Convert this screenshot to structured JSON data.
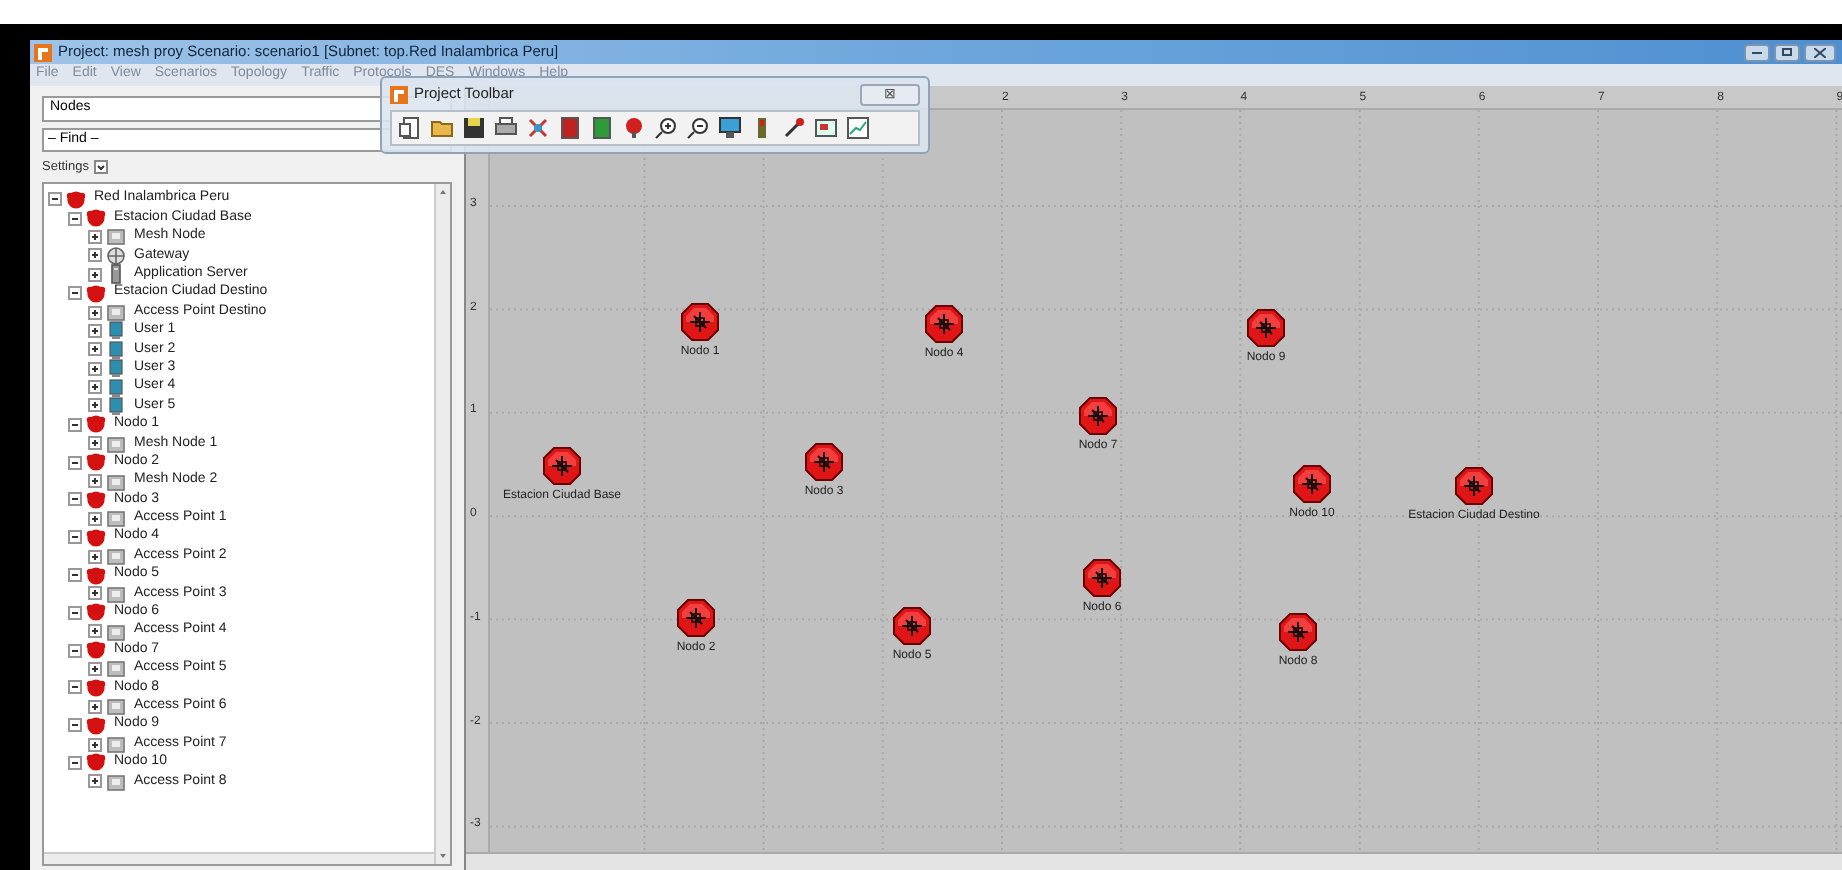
{
  "window": {
    "title": "Project: mesh proy Scenario: scenario1  [Subnet: top.Red Inalambrica Peru]"
  },
  "menu": [
    "File",
    "Edit",
    "View",
    "Scenarios",
    "Topology",
    "Traffic",
    "Protocols",
    "DES",
    "Windows",
    "Help"
  ],
  "toolbar_window": {
    "title": "Project Toolbar",
    "close": "⊠"
  },
  "panel": {
    "view_selector": {
      "value": "Nodes"
    },
    "find_field": {
      "value": "– Find –"
    },
    "settings_label": "Settings",
    "tree": [
      {
        "label": "Red Inalambrica Peru",
        "kind": "subnet",
        "expanded": true,
        "children": [
          {
            "label": "Estacion Ciudad Base",
            "kind": "subnet",
            "expanded": true,
            "children": [
              {
                "label": "Mesh Node",
                "kind": "device",
                "expanded": false
              },
              {
                "label": "Gateway",
                "kind": "gateway",
                "expanded": false
              },
              {
                "label": "Application Server",
                "kind": "server",
                "expanded": false
              }
            ]
          },
          {
            "label": "Estacion Ciudad Destino",
            "kind": "subnet",
            "expanded": true,
            "children": [
              {
                "label": "Access Point Destino",
                "kind": "device",
                "expanded": false
              },
              {
                "label": "User 1",
                "kind": "user",
                "expanded": false
              },
              {
                "label": "User 2",
                "kind": "user",
                "expanded": false
              },
              {
                "label": "User 3",
                "kind": "user",
                "expanded": false
              },
              {
                "label": "User 4",
                "kind": "user",
                "expanded": false
              },
              {
                "label": "User 5",
                "kind": "user",
                "expanded": false
              }
            ]
          },
          {
            "label": "Nodo 1",
            "kind": "subnet",
            "expanded": true,
            "children": [
              {
                "label": "Mesh Node 1",
                "kind": "device",
                "expanded": false
              }
            ]
          },
          {
            "label": "Nodo 2",
            "kind": "subnet",
            "expanded": true,
            "children": [
              {
                "label": "Mesh Node 2",
                "kind": "device",
                "expanded": false
              }
            ]
          },
          {
            "label": "Nodo 3",
            "kind": "subnet",
            "expanded": true,
            "children": [
              {
                "label": "Access Point 1",
                "kind": "device",
                "expanded": false
              }
            ]
          },
          {
            "label": "Nodo 4",
            "kind": "subnet",
            "expanded": true,
            "children": [
              {
                "label": "Access Point 2",
                "kind": "device",
                "expanded": false
              }
            ]
          },
          {
            "label": "Nodo 5",
            "kind": "subnet",
            "expanded": true,
            "children": [
              {
                "label": "Access Point 3",
                "kind": "device",
                "expanded": false
              }
            ]
          },
          {
            "label": "Nodo 6",
            "kind": "subnet",
            "expanded": true,
            "children": [
              {
                "label": "Access Point 4",
                "kind": "device",
                "expanded": false
              }
            ]
          },
          {
            "label": "Nodo 7",
            "kind": "subnet",
            "expanded": true,
            "children": [
              {
                "label": "Access Point 5",
                "kind": "device",
                "expanded": false
              }
            ]
          },
          {
            "label": "Nodo 8",
            "kind": "subnet",
            "expanded": true,
            "children": [
              {
                "label": "Access Point 6",
                "kind": "device",
                "expanded": false
              }
            ]
          },
          {
            "label": "Nodo 9",
            "kind": "subnet",
            "expanded": true,
            "children": [
              {
                "label": "Access Point 7",
                "kind": "device",
                "expanded": false
              }
            ]
          },
          {
            "label": "Nodo 10",
            "kind": "subnet",
            "expanded": true,
            "children": [
              {
                "label": "Access Point 8",
                "kind": "device",
                "expanded": false
              }
            ]
          }
        ]
      }
    ]
  },
  "canvas": {
    "x_ticks": [
      "2",
      "3",
      "4",
      "5",
      "6",
      "7",
      "8",
      "9"
    ],
    "y_ticks": [
      "3",
      "2",
      "1",
      "0",
      "-1",
      "-2",
      "-3"
    ],
    "nodes": [
      {
        "label": "Nodo 1"
      },
      {
        "label": "Nodo 4"
      },
      {
        "label": "Nodo 9"
      },
      {
        "label": "Nodo 7"
      },
      {
        "label": "Estacion Ciudad Base"
      },
      {
        "label": "Nodo 3"
      },
      {
        "label": "Nodo 10"
      },
      {
        "label": "Estacion Ciudad Destino"
      },
      {
        "label": "Nodo 6"
      },
      {
        "label": "Nodo 2"
      },
      {
        "label": "Nodo 5"
      },
      {
        "label": "Nodo 8"
      }
    ]
  }
}
